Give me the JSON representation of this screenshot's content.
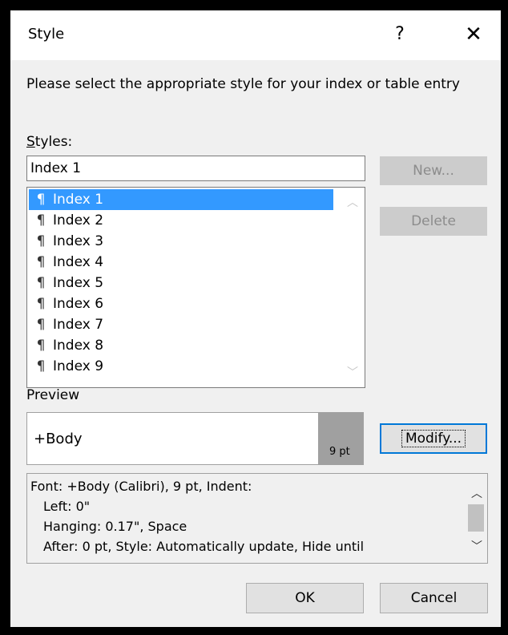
{
  "window": {
    "title": "Style",
    "help_label": "?",
    "close_label": "✕"
  },
  "instructions": "Please select the appropriate style for your index or table entry",
  "styles": {
    "label_hotkey": "S",
    "label_rest": "tyles:",
    "input_value": "Index 1",
    "items": [
      {
        "symbol": "¶",
        "label": "Index 1",
        "selected": true
      },
      {
        "symbol": "¶",
        "label": "Index 2"
      },
      {
        "symbol": "¶",
        "label": "Index 3"
      },
      {
        "symbol": "¶",
        "label": "Index 4"
      },
      {
        "symbol": "¶",
        "label": "Index 5"
      },
      {
        "symbol": "¶",
        "label": "Index 6"
      },
      {
        "symbol": "¶",
        "label": "Index 7"
      },
      {
        "symbol": "¶",
        "label": "Index 8"
      },
      {
        "symbol": "¶",
        "label": "Index 9"
      }
    ],
    "scroll_up_icon": "chevron-up-icon",
    "scroll_down_icon": "chevron-down-icon"
  },
  "buttons": {
    "new_label": "New...",
    "delete_label": "Delete",
    "modify_label": "Modify...",
    "ok_label": "OK",
    "cancel_label": "Cancel"
  },
  "preview": {
    "label": "Preview",
    "text": "+Body",
    "size_badge": "9 pt"
  },
  "description": {
    "lines": [
      "Font: +Body (Calibri), 9 pt, Indent:",
      "Left:  0\"",
      "Hanging:  0.17\", Space",
      "After:  0 pt, Style: Automatically update, Hide until"
    ]
  },
  "colors": {
    "selection": "#3399ff",
    "focus_border": "#0078d7",
    "dialog_bg": "#f0f0f0"
  }
}
